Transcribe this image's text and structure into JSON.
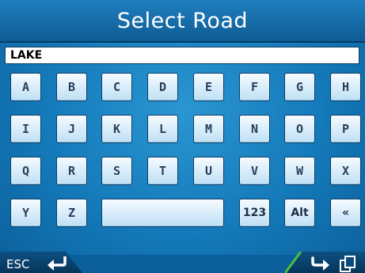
{
  "title": "Select Road",
  "input": {
    "value": "LAKE"
  },
  "keys": {
    "row1": [
      "A",
      "B",
      "C",
      "D",
      "E",
      "F",
      "G",
      "H"
    ],
    "row2": [
      "I",
      "J",
      "K",
      "L",
      "M",
      "N",
      "O",
      "P"
    ],
    "row3": [
      "Q",
      "R",
      "S",
      "T",
      "U",
      "V",
      "W",
      "X"
    ],
    "row4": {
      "y": "Y",
      "z": "Z",
      "space": "",
      "numbers": "123",
      "alt": "Alt",
      "backspace": "«"
    }
  },
  "footer": {
    "esc_label": "ESC"
  },
  "icons": {
    "esc": "return-arrow-icon",
    "next": "next-arrow-icon",
    "copy": "copy-icon"
  },
  "colors": {
    "background": "#1479b9",
    "key_face": "#d6ecfa",
    "accent_green": "#4fbf3a"
  }
}
